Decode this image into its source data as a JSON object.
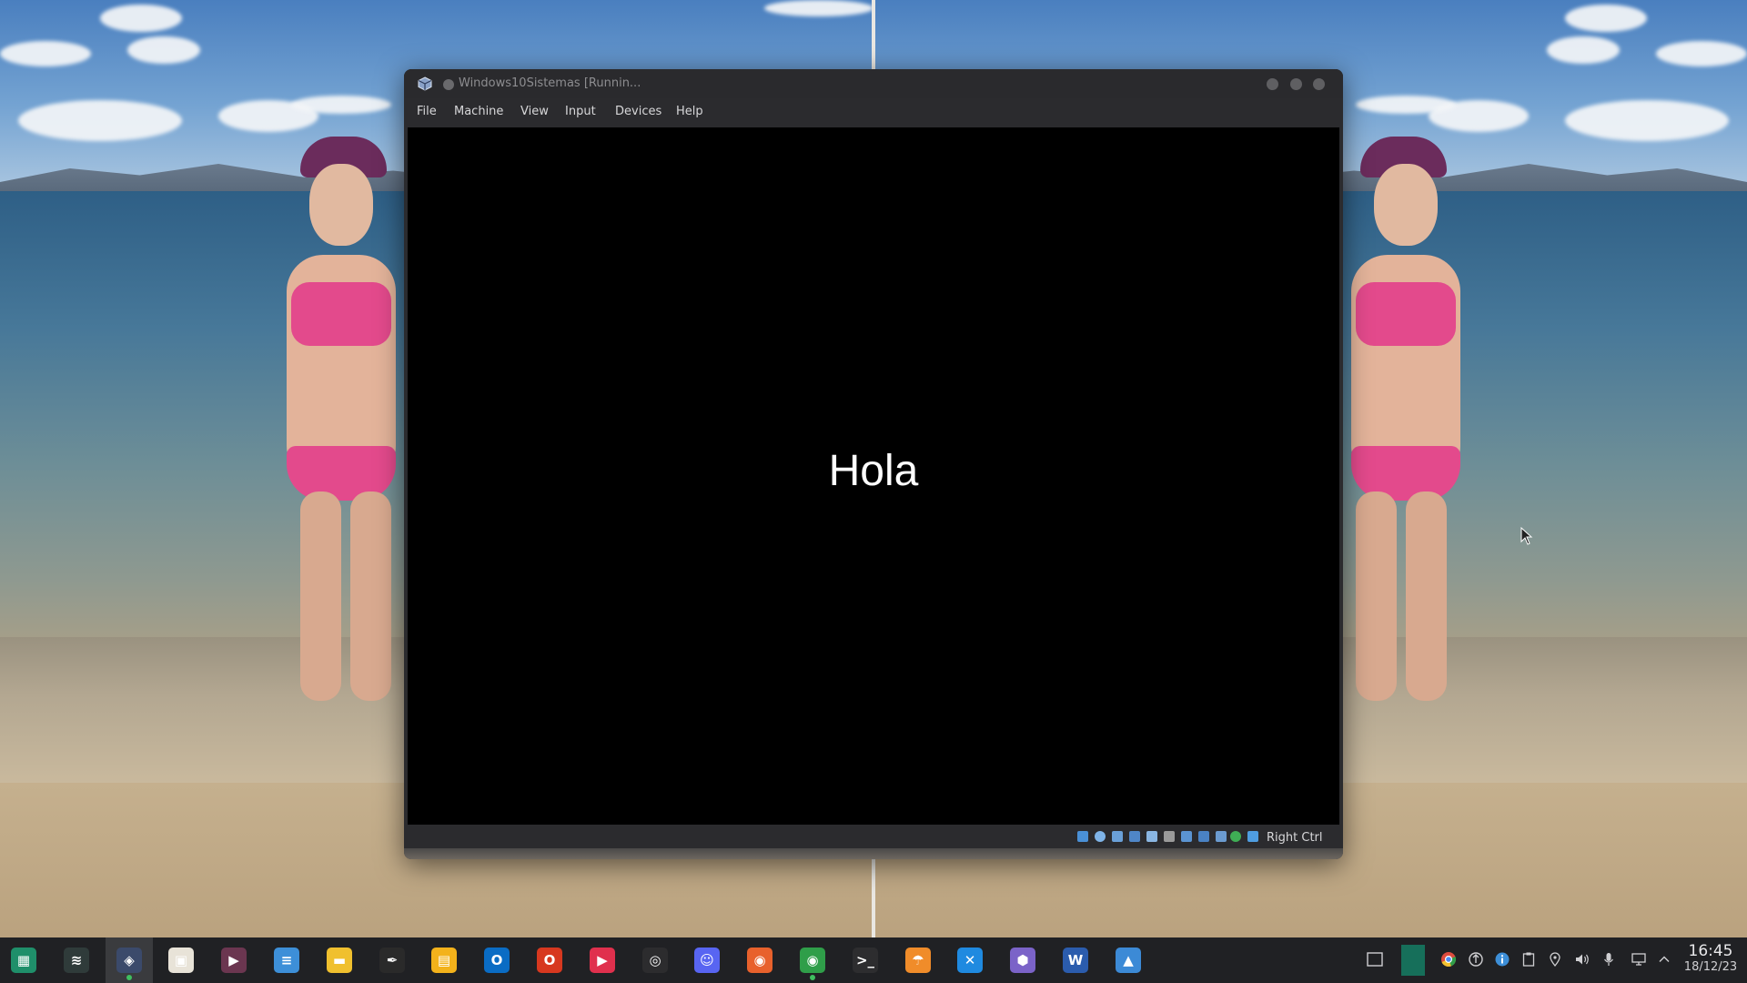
{
  "window": {
    "title": "Windows10Sistemas [Runnin...",
    "menu": [
      "File",
      "Machine",
      "View",
      "Input",
      "Devices",
      "Help"
    ],
    "guest_text": "Hola",
    "status_icons": [
      "hard-disk-icon",
      "optical-disk-icon",
      "audio-icon",
      "network-icon",
      "usb-icon",
      "shared-folder-icon",
      "display-icon",
      "video-capture-icon",
      "recording-icon",
      "cpu-icon",
      "mouse-integration-icon",
      "keyboard-icon"
    ],
    "host_key": "Right Ctrl"
  },
  "taskbar": {
    "apps": [
      {
        "name": "app-launcher",
        "icon": "launcher-icon",
        "color": "#1f8f6a",
        "glyph": "▦"
      },
      {
        "name": "system-monitor",
        "icon": "system-monitor-icon",
        "color": "#2f3b3a",
        "glyph": "≋"
      },
      {
        "name": "virtualbox",
        "icon": "virtualbox-icon",
        "color": "#3b4a6b",
        "glyph": "◈",
        "active": true,
        "running": true
      },
      {
        "name": "store",
        "icon": "store-icon",
        "color": "#e8e3d8",
        "glyph": "▣"
      },
      {
        "name": "video-editor",
        "icon": "video-editor-icon",
        "color": "#6b3650",
        "glyph": "▶"
      },
      {
        "name": "notes",
        "icon": "notes-icon",
        "color": "#3d8fd8",
        "glyph": "≡"
      },
      {
        "name": "file-manager",
        "icon": "folder-icon",
        "color": "#f0c02e",
        "glyph": "▬"
      },
      {
        "name": "pen-tool",
        "icon": "pen-icon",
        "color": "#2a2a2a",
        "glyph": "✒"
      },
      {
        "name": "files",
        "icon": "files-icon",
        "color": "#f3b21b",
        "glyph": "▤"
      },
      {
        "name": "outlook",
        "icon": "outlook-icon",
        "color": "#0a6cc4",
        "glyph": "O"
      },
      {
        "name": "office",
        "icon": "office-icon",
        "color": "#d7381f",
        "glyph": "O"
      },
      {
        "name": "media-player",
        "icon": "play-icon",
        "color": "#e0304d",
        "glyph": "▶"
      },
      {
        "name": "obs",
        "icon": "obs-icon",
        "color": "#2c2c2e",
        "glyph": "◎"
      },
      {
        "name": "discord",
        "icon": "discord-icon",
        "color": "#5865f2",
        "glyph": "☺"
      },
      {
        "name": "firefox",
        "icon": "firefox-icon",
        "color": "#e8612c",
        "glyph": "◉"
      },
      {
        "name": "chrome",
        "icon": "chrome-icon",
        "color": "#2f9e49",
        "glyph": "◉",
        "running": true
      },
      {
        "name": "terminal",
        "icon": "terminal-icon",
        "color": "#2d2d2f",
        "glyph": ">_"
      },
      {
        "name": "bookmark-app",
        "icon": "umbrella-icon",
        "color": "#f08c2a",
        "glyph": "☂"
      },
      {
        "name": "vscode",
        "icon": "vscode-icon",
        "color": "#1f8ae0",
        "glyph": "✕"
      },
      {
        "name": "package-app",
        "icon": "cube-icon",
        "color": "#7b63c8",
        "glyph": "⬢"
      },
      {
        "name": "word",
        "icon": "word-icon",
        "color": "#2b5cad",
        "glyph": "W"
      },
      {
        "name": "image-viewer",
        "icon": "image-icon",
        "color": "#3c8ad6",
        "glyph": "▲"
      }
    ],
    "clock": {
      "time": "16:45",
      "date": "18/12/23"
    }
  }
}
